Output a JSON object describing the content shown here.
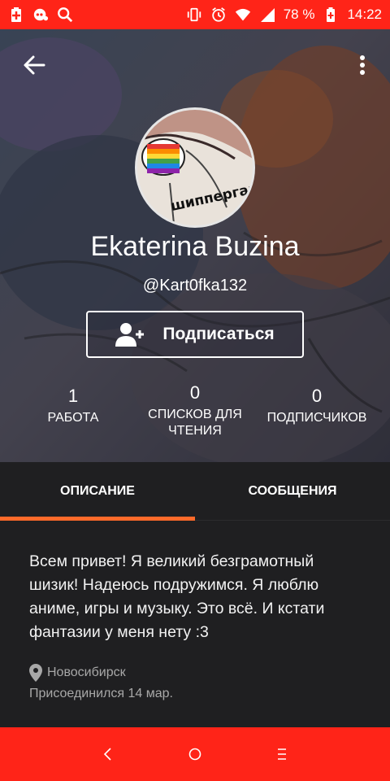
{
  "status_bar": {
    "battery_percent": "78 %",
    "time": "14:22",
    "left_icons": [
      "battery-charging-icon",
      "notification-icon",
      "search-icon"
    ],
    "right_icons": [
      "vibrate-icon",
      "alarm-icon",
      "wifi-icon",
      "signal-icon",
      "battery-icon"
    ]
  },
  "header": {
    "avatar_caption": "шипперган",
    "name": "Ekaterina Buzina",
    "username": "@Kart0fka132",
    "follow_label": "Подписаться"
  },
  "stats": [
    {
      "value": "1",
      "label": "РАБОТА"
    },
    {
      "value": "0",
      "label": "СПИСКОВ ДЛЯ ЧТЕНИЯ"
    },
    {
      "value": "0",
      "label": "ПОДПИСЧИКОВ"
    }
  ],
  "tabs": [
    {
      "label": "ОПИСАНИЕ",
      "active": true
    },
    {
      "label": "СООБЩЕНИЯ",
      "active": false
    }
  ],
  "about": {
    "bio": "Всем привет! Я великий безграмотный шизик! Надеюсь подружимся. Я люблю аниме, игры и музыку. Это всё. И кстати фантазии у меня нету :3",
    "location": "Новосибирск",
    "joined": "Присоединился 14 мар."
  },
  "colors": {
    "system_bar": "#ff2418",
    "accent": "#ff6a2a",
    "background": "#1f1f21"
  }
}
